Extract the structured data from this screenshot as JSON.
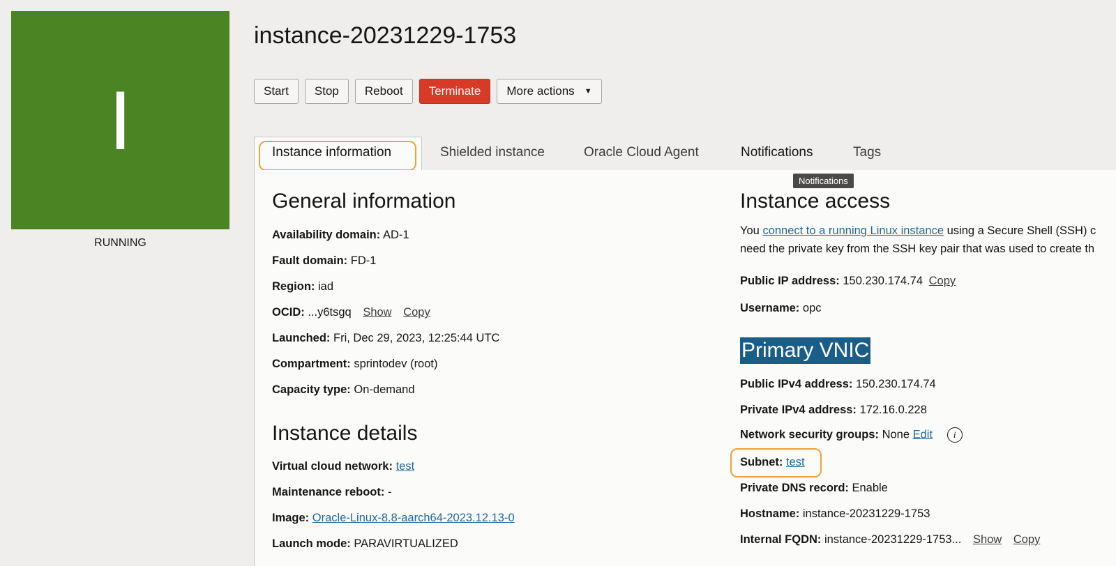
{
  "instance": {
    "letter": "I",
    "status": "RUNNING",
    "title": "instance-20231229-1753",
    "badge_color": "#4b8423"
  },
  "actions": {
    "start": "Start",
    "stop": "Stop",
    "reboot": "Reboot",
    "terminate": "Terminate",
    "more": "More actions",
    "more_icon": "chevron-down-icon"
  },
  "tabs": {
    "instance_information": "Instance information",
    "shielded_instance": "Shielded instance",
    "oracle_cloud_agent": "Oracle Cloud Agent",
    "notifications": "Notifications",
    "tags": "Tags",
    "tooltip": "Notifications"
  },
  "general": {
    "heading": "General information",
    "availability_label": "Availability domain:",
    "availability_value": "AD-1",
    "fault_label": "Fault domain:",
    "fault_value": "FD-1",
    "region_label": "Region:",
    "region_value": "iad",
    "ocid_label": "OCID:",
    "ocid_value": "...y6tsgq",
    "ocid_show": "Show",
    "ocid_copy": "Copy",
    "launched_label": "Launched:",
    "launched_value": "Fri, Dec 29, 2023, 12:25:44 UTC",
    "compartment_label": "Compartment:",
    "compartment_value": "sprintodev (root)",
    "capacity_label": "Capacity type:",
    "capacity_value": "On-demand"
  },
  "details": {
    "heading": "Instance details",
    "vcn_label": "Virtual cloud network:",
    "vcn_value": "test",
    "maintenance_label": "Maintenance reboot:",
    "maintenance_value": "-",
    "image_label": "Image:",
    "image_value": "Oracle-Linux-8.8-aarch64-2023.12.13-0",
    "launch_mode_label": "Launch mode:",
    "launch_mode_value": "PARAVIRTUALIZED"
  },
  "access": {
    "heading": "Instance access",
    "line1_pre": "You ",
    "line1_link": "connect to a running Linux instance",
    "line1_post": " using a Secure Shell (SSH) c",
    "line2": "need the private key from the SSH key pair that was used to create th",
    "public_ip_label": "Public IP address:",
    "public_ip_value": "150.230.174.74",
    "public_ip_copy": "Copy",
    "username_label": "Username:",
    "username_value": "opc"
  },
  "vnic": {
    "heading": "Primary VNIC",
    "public_ipv4_label": "Public IPv4 address:",
    "public_ipv4_value": "150.230.174.74",
    "private_ipv4_label": "Private IPv4 address:",
    "private_ipv4_value": "172.16.0.228",
    "nsg_label": "Network security groups:",
    "nsg_value": "None",
    "nsg_edit": "Edit",
    "subnet_label": "Subnet:",
    "subnet_value": "test",
    "dns_label": "Private DNS record:",
    "dns_value": "Enable",
    "hostname_label": "Hostname:",
    "hostname_value": "instance-20231229-1753",
    "fqdn_label": "Internal FQDN:",
    "fqdn_value": "instance-20231229-1753...",
    "fqdn_show": "Show",
    "fqdn_copy": "Copy"
  }
}
